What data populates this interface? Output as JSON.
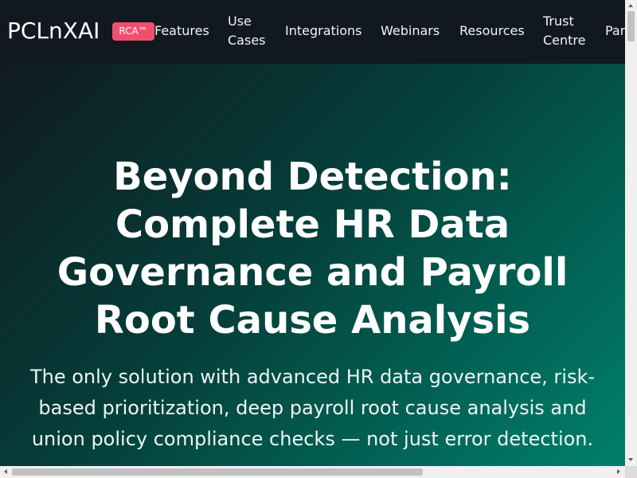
{
  "navbar": {
    "brand": "PCLnXAI",
    "badge": "RCA™",
    "links": {
      "features": "Features",
      "use_cases_line1": "Use",
      "use_cases_line2": "Cases",
      "integrations": "Integrations",
      "webinars": "Webinars",
      "resources": "Resources",
      "trust_line1": "Trust",
      "trust_line2": "Centre",
      "partial": "Par"
    }
  },
  "hero": {
    "title_lines": [
      "Beyond Detection:",
      "Complete HR Data",
      "Governance and Payroll",
      "Root Cause Analysis"
    ],
    "subtitle_lines": [
      "The only solution with advanced HR data governance, risk-",
      "based prioritization, deep payroll root cause analysis and",
      "union policy compliance checks — not just error detection."
    ]
  },
  "colors": {
    "navbar_bg": "#111820",
    "badge_bg": "#f0506e",
    "hero_gradient_start": "#101a21",
    "hero_gradient_end": "#00806c"
  }
}
